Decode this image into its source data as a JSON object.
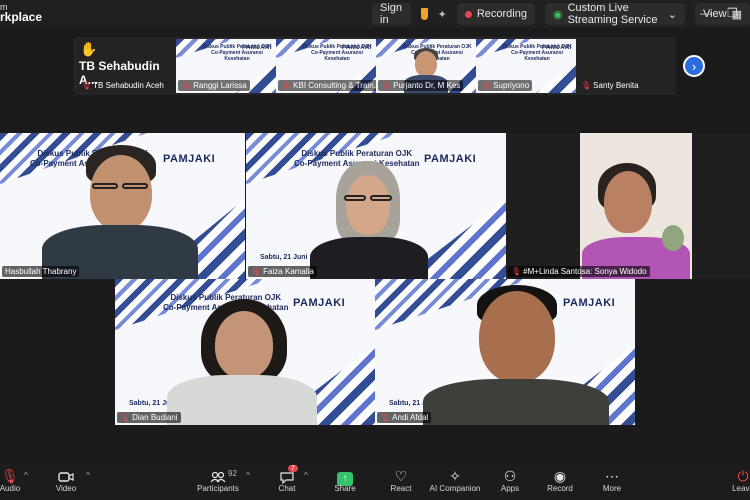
{
  "app": {
    "brand_line1": "m",
    "brand_line2": "rkplace"
  },
  "topbar": {
    "sign_in": "Sign in",
    "recording": "Recording",
    "live_streaming": "Custom Live Streaming Service",
    "view": "View"
  },
  "filmstrip": {
    "items": [
      {
        "name": "TB Sehabudin Aceh",
        "display_name": "TB Sehabudin A..."
      },
      {
        "name": "Ranggi Larissa"
      },
      {
        "name": "KBI Consulting & Train..."
      },
      {
        "name": "Purjanto Dr, M Kes"
      },
      {
        "name": "Supriyono"
      },
      {
        "name": "Santy Benita"
      }
    ]
  },
  "slide": {
    "title_line1": "Diskus Publik Peraturan OJK",
    "title_line2": "Co-Payment Asuransi Kesehatan",
    "logo_text": "PAMJAKI",
    "date": "Sabtu, 21 Juni"
  },
  "tiles": [
    {
      "name": "Hasbullah Thabrany"
    },
    {
      "name": "Faiza Kamalia"
    },
    {
      "name": "#M+Linda Santosa: Sonya Widodo"
    },
    {
      "name": "Dian Budiani"
    },
    {
      "name": "Andi Afdal"
    }
  ],
  "toolbar": {
    "audio": "Audio",
    "video": "Video",
    "participants": "Participants",
    "participants_count": "92",
    "chat": "Chat",
    "chat_badge": "7",
    "share": "Share",
    "react": "React",
    "ai_companion": "AI Companion",
    "apps": "Apps",
    "record": "Record",
    "more": "More",
    "leave": "Leave"
  },
  "colors": {
    "accent_green": "#36c26a",
    "recording_red": "#e5484d",
    "nav_blue": "#2d6cdf",
    "slide_navy": "#1b2a5c"
  }
}
